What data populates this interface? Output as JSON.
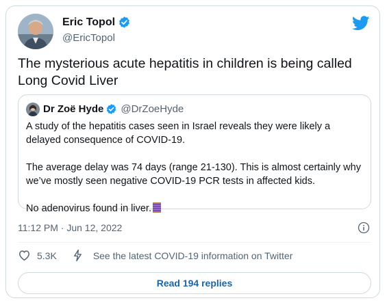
{
  "author": {
    "name": "Eric Topol",
    "handle": "@EricTopol",
    "verified": true
  },
  "tweet": {
    "text": "The mysterious acute hepatitis in children is being called Long Covid Liver"
  },
  "quoted_tweet": {
    "name": "Dr Zoë Hyde",
    "handle": "@DrZoeHyde",
    "verified": true,
    "paragraphs": [
      "A study of the hepatitis cases seen in Israel reveals they were likely a delayed consequence of COVID-19.",
      "The average delay was 74 days (range 21-130). This is almost certainly why we’ve mostly seen negative COVID-19 PCR tests in affected kids.",
      "No adenovirus found in liver."
    ],
    "emoji": "thread-icon"
  },
  "meta": {
    "time": "11:12 PM",
    "separator": "·",
    "date": "Jun 12, 2022"
  },
  "actions": {
    "likes": "5.3K",
    "covid_info": "See the latest COVID-19 information on Twitter"
  },
  "replies_button": "Read 194 replies",
  "colors": {
    "verified": "#1d9bf0",
    "twitter_blue": "#1d9bf0",
    "text": "#0f1419",
    "secondary": "#536471",
    "border": "#cfd9de",
    "link": "#1d64a0"
  }
}
